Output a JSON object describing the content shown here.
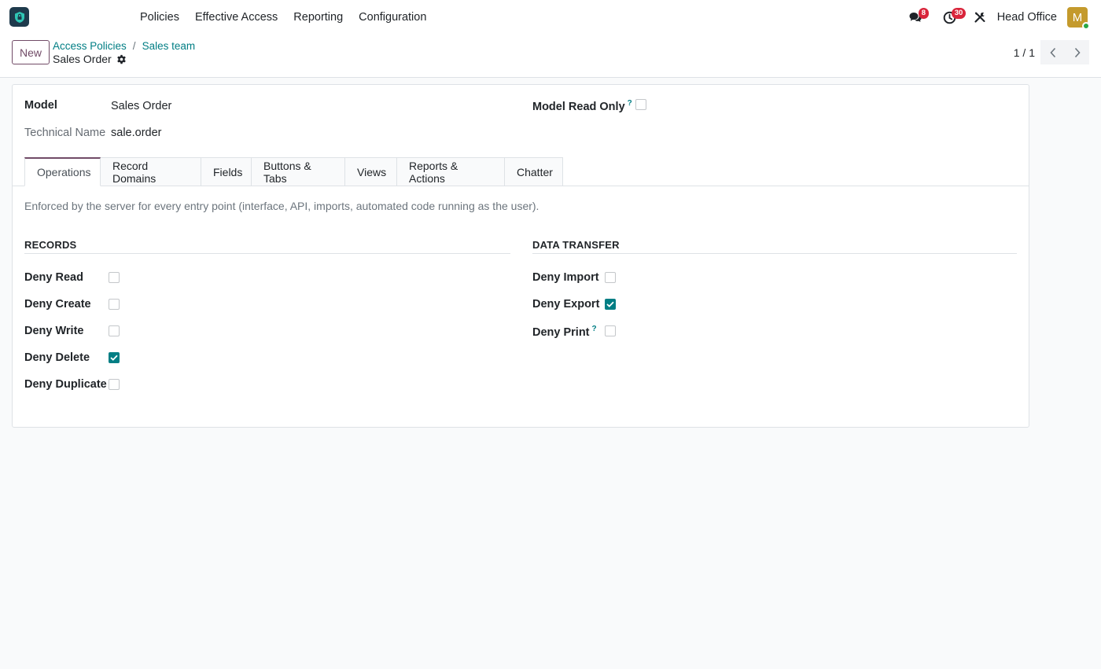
{
  "navbar": {
    "app_icon": "shield-lock-icon",
    "menu": [
      "Policies",
      "Effective Access",
      "Reporting",
      "Configuration"
    ],
    "messages_count": "8",
    "activities_count": "30",
    "company": "Head Office",
    "avatar_initial": "M"
  },
  "control": {
    "new_label": "New",
    "breadcrumb": [
      "Access Policies",
      "Sales team"
    ],
    "separator": "/",
    "record_title": "Sales Order",
    "pager": "1 / 1"
  },
  "form": {
    "model_label": "Model",
    "model_value": "Sales Order",
    "technical_label": "Technical Name",
    "technical_value": "sale.order",
    "read_only_label": "Model Read Only",
    "read_only_help": "?",
    "read_only_checked": false,
    "tabs": [
      "Operations",
      "Record Domains",
      "Fields",
      "Buttons & Tabs",
      "Views",
      "Reports & Actions",
      "Chatter"
    ],
    "active_tab": "Operations",
    "help_text": "Enforced by the server for every entry point (interface, API, imports, automated code running as the user).",
    "records": {
      "title": "RECORDS",
      "items": [
        {
          "label": "Deny Read",
          "checked": false
        },
        {
          "label": "Deny Create",
          "checked": false
        },
        {
          "label": "Deny Write",
          "checked": false
        },
        {
          "label": "Deny Delete",
          "checked": true
        },
        {
          "label": "Deny Duplicate",
          "checked": false
        }
      ]
    },
    "data_transfer": {
      "title": "DATA TRANSFER",
      "items": [
        {
          "label": "Deny Import",
          "checked": false
        },
        {
          "label": "Deny Export",
          "checked": true
        },
        {
          "label": "Deny Print",
          "checked": false,
          "help": "?"
        }
      ]
    }
  },
  "colors": {
    "accent": "#017e84",
    "brand": "#714b67",
    "badge": "#d9253b"
  }
}
